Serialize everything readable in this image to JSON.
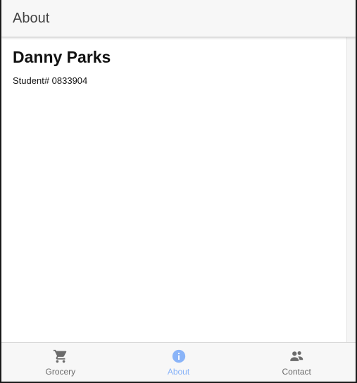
{
  "header": {
    "title": "About"
  },
  "profile": {
    "name": "Danny Parks",
    "student_line": "Student# 0833904"
  },
  "tabs": [
    {
      "label": "Grocery",
      "icon": "cart-icon",
      "active": false
    },
    {
      "label": "About",
      "icon": "info-icon",
      "active": true
    },
    {
      "label": "Contact",
      "icon": "contacts-icon",
      "active": false
    }
  ],
  "colors": {
    "accent": "#8ab4f8",
    "inactive": "#6b6b6b",
    "header_bg": "#f7f7f7"
  }
}
